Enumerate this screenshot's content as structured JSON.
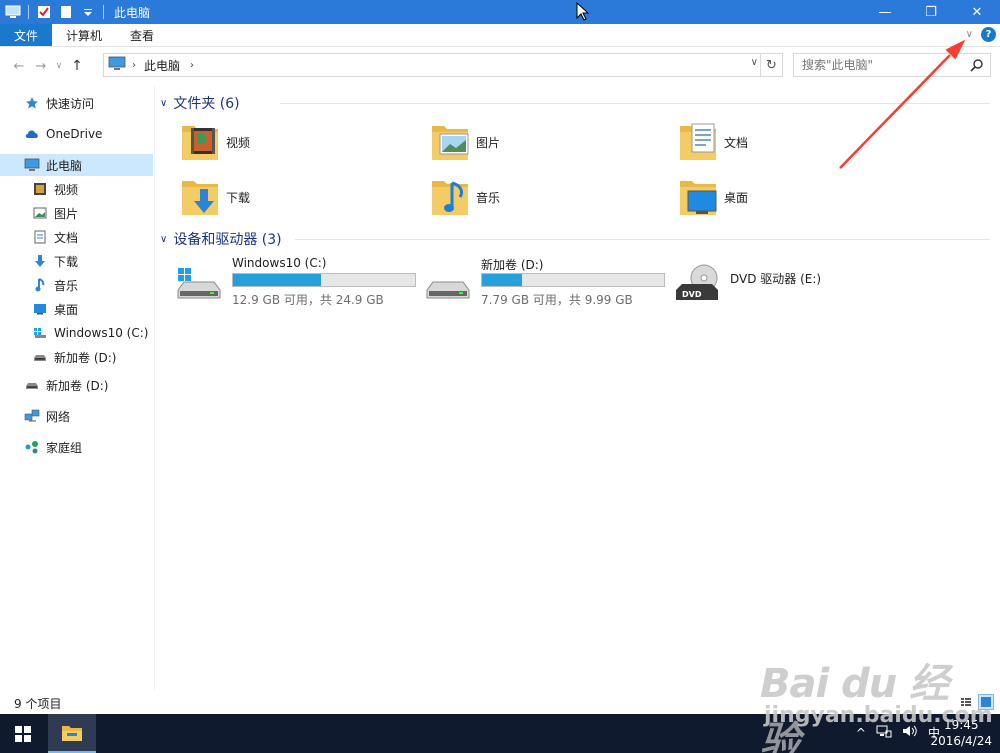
{
  "window": {
    "title": "此电脑",
    "minimize_glyph": "—",
    "maximize_glyph": "❐",
    "close_glyph": "✕"
  },
  "ribbon": {
    "tabs": [
      "文件",
      "计算机",
      "查看"
    ],
    "expand_glyph": "∨",
    "help_glyph": "?"
  },
  "address": {
    "back_glyph": "←",
    "forward_glyph": "→",
    "recent_glyph": "∨",
    "up_glyph": "↑",
    "crumb": "此电脑",
    "crumb_chevron": "›",
    "dropdown_glyph": "∨",
    "refresh_glyph": "↻",
    "search_placeholder": "搜索\"此电脑\""
  },
  "sidebar": {
    "items": [
      {
        "label": "快速访问",
        "icon": "star-pin-icon"
      },
      {
        "label": "OneDrive",
        "icon": "cloud-icon"
      },
      {
        "label": "此电脑",
        "icon": "computer-icon",
        "selected": true
      },
      {
        "label": "视频",
        "icon": "video-icon"
      },
      {
        "label": "图片",
        "icon": "pictures-icon"
      },
      {
        "label": "文档",
        "icon": "document-icon"
      },
      {
        "label": "下载",
        "icon": "download-icon"
      },
      {
        "label": "音乐",
        "icon": "music-icon"
      },
      {
        "label": "桌面",
        "icon": "desktop-icon"
      },
      {
        "label": "Windows10 (C:)",
        "icon": "windows-drive-icon"
      },
      {
        "label": "新加卷 (D:)",
        "icon": "drive-icon"
      },
      {
        "label": "新加卷 (D:)",
        "icon": "drive-icon"
      },
      {
        "label": "网络",
        "icon": "network-icon"
      },
      {
        "label": "家庭组",
        "icon": "homegroup-icon"
      }
    ]
  },
  "folders": {
    "header": "文件夹 (6)",
    "chevron": "∨",
    "items": [
      {
        "label": "视频",
        "icon": "video-folder-icon"
      },
      {
        "label": "图片",
        "icon": "pictures-folder-icon"
      },
      {
        "label": "文档",
        "icon": "documents-folder-icon"
      },
      {
        "label": "下载",
        "icon": "downloads-folder-icon"
      },
      {
        "label": "音乐",
        "icon": "music-folder-icon"
      },
      {
        "label": "桌面",
        "icon": "desktop-folder-icon"
      }
    ]
  },
  "devices": {
    "header": "设备和驱动器 (3)",
    "chevron": "∨",
    "items": [
      {
        "label": "Windows10 (C:)",
        "info": "12.9 GB 可用，共 24.9 GB",
        "used_fraction": 0.482,
        "icon": "windows-drive-icon"
      },
      {
        "label": "新加卷 (D:)",
        "info": "7.79 GB 可用，共 9.99 GB",
        "used_fraction": 0.22,
        "icon": "drive-icon"
      },
      {
        "label": "DVD 驱动器 (E:)",
        "icon": "dvd-drive-icon",
        "dvd_text": "DVD"
      }
    ]
  },
  "status": {
    "count": "9 个项目"
  },
  "taskbar": {
    "tray_chevron": "^",
    "ime": "中",
    "time": "19:45",
    "date": "2016/4/24"
  },
  "watermark": {
    "line1": "Bai du 经验",
    "line2": "jingyan.baidu.com"
  },
  "colors": {
    "titlebar": "#2b79d8",
    "file_tab": "#1979ca",
    "selection": "#cce8ff",
    "group_header": "#1e3287",
    "bar_fill": "#26a0da",
    "taskbar": "#101a2e",
    "arrow": "#ff3b30"
  }
}
